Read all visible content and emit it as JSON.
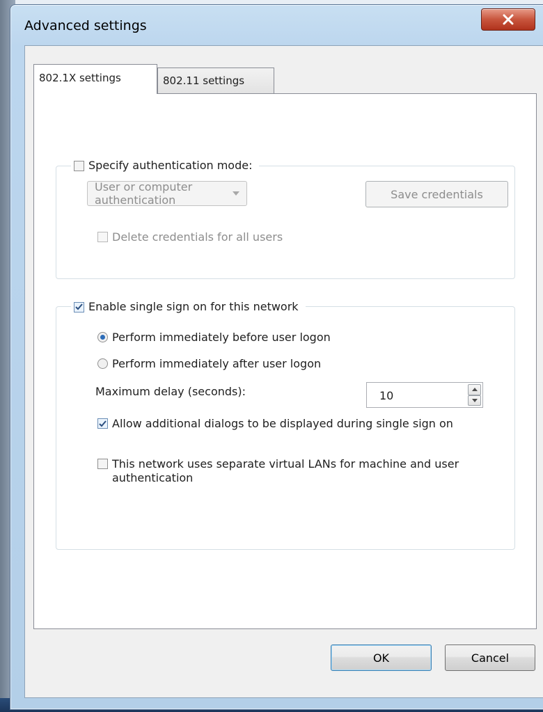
{
  "window": {
    "title": "Advanced settings"
  },
  "tabs": [
    {
      "label": "802.1X settings",
      "active": true
    },
    {
      "label": "802.11 settings",
      "active": false
    }
  ],
  "auth_group": {
    "checkbox_label": "Specify authentication mode:",
    "checked": false,
    "mode_select": {
      "value": "User or computer authentication",
      "enabled": false
    },
    "save_credentials_label": "Save credentials",
    "delete_credentials_label": "Delete credentials for all users"
  },
  "sso_group": {
    "checkbox_label": "Enable single sign on for this network",
    "checked": true,
    "radio_before_label": "Perform immediately before user logon",
    "radio_after_label": "Perform immediately after user logon",
    "selected_radio": "before",
    "max_delay_label": "Maximum delay (seconds):",
    "max_delay_value": "10",
    "allow_dialogs_label": "Allow additional dialogs to be displayed during single sign on",
    "allow_dialogs_checked": true,
    "vlan_label": "This network uses separate virtual LANs for machine and user authentication",
    "vlan_checked": false
  },
  "footer": {
    "ok_label": "OK",
    "cancel_label": "Cancel"
  },
  "colors": {
    "accent": "#2c6cb8",
    "close": "#c8553d"
  }
}
